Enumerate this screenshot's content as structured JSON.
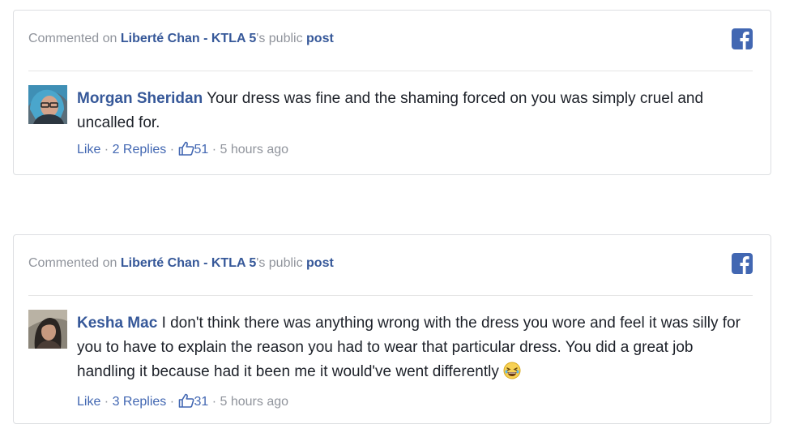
{
  "cards": [
    {
      "header": {
        "prefix": "Commented on ",
        "page_name": "Liberté Chan - KTLA 5",
        "suffix": "'s public ",
        "post_link": "post"
      },
      "comment": {
        "author": "Morgan Sheridan",
        "text": "Your dress was fine and the shaming forced on you was simply cruel and uncalled for.",
        "like_label": "Like",
        "replies_label": "2 Replies",
        "like_count": "51",
        "timestamp": "5 hours ago"
      }
    },
    {
      "header": {
        "prefix": "Commented on ",
        "page_name": "Liberté Chan - KTLA 5",
        "suffix": "'s public ",
        "post_link": "post"
      },
      "comment": {
        "author": "Kesha Mac",
        "text": "I don't think there was anything wrong with the dress you wore and feel it was silly for you to have to explain the reason you had to wear that particular dress. You did a great job handling it because had it been me it would've went differently",
        "like_label": "Like",
        "replies_label": "3 Replies",
        "like_count": "31",
        "timestamp": "5 hours ago"
      }
    }
  ],
  "separator": " · ",
  "colors": {
    "link": "#365899",
    "muted": "#90949c",
    "facebook_blue": "#4267b2",
    "text": "#1d2129"
  },
  "icons": {
    "platform": "facebook-icon",
    "like": "thumbs-up-icon",
    "emoji": "laughing-emoji-icon"
  }
}
